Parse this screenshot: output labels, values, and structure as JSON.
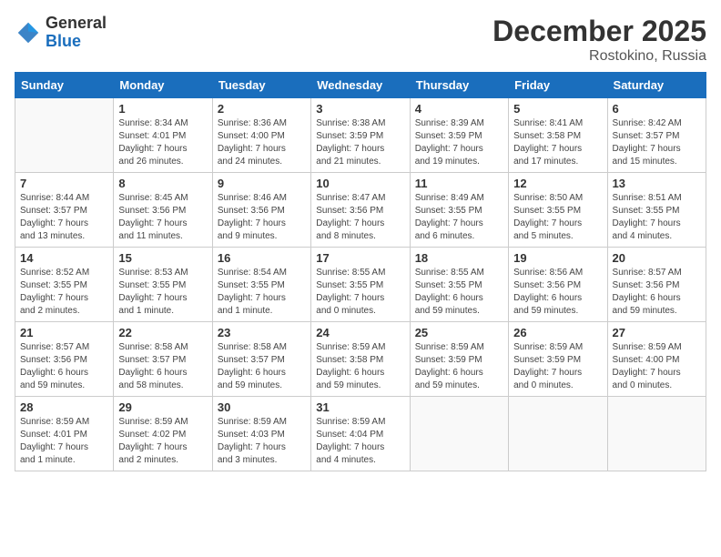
{
  "header": {
    "logo_general": "General",
    "logo_blue": "Blue",
    "title": "December 2025",
    "subtitle": "Rostokino, Russia"
  },
  "days_of_week": [
    "Sunday",
    "Monday",
    "Tuesday",
    "Wednesday",
    "Thursday",
    "Friday",
    "Saturday"
  ],
  "weeks": [
    [
      {
        "day": "",
        "info": ""
      },
      {
        "day": "1",
        "info": "Sunrise: 8:34 AM\nSunset: 4:01 PM\nDaylight: 7 hours\nand 26 minutes."
      },
      {
        "day": "2",
        "info": "Sunrise: 8:36 AM\nSunset: 4:00 PM\nDaylight: 7 hours\nand 24 minutes."
      },
      {
        "day": "3",
        "info": "Sunrise: 8:38 AM\nSunset: 3:59 PM\nDaylight: 7 hours\nand 21 minutes."
      },
      {
        "day": "4",
        "info": "Sunrise: 8:39 AM\nSunset: 3:59 PM\nDaylight: 7 hours\nand 19 minutes."
      },
      {
        "day": "5",
        "info": "Sunrise: 8:41 AM\nSunset: 3:58 PM\nDaylight: 7 hours\nand 17 minutes."
      },
      {
        "day": "6",
        "info": "Sunrise: 8:42 AM\nSunset: 3:57 PM\nDaylight: 7 hours\nand 15 minutes."
      }
    ],
    [
      {
        "day": "7",
        "info": "Sunrise: 8:44 AM\nSunset: 3:57 PM\nDaylight: 7 hours\nand 13 minutes."
      },
      {
        "day": "8",
        "info": "Sunrise: 8:45 AM\nSunset: 3:56 PM\nDaylight: 7 hours\nand 11 minutes."
      },
      {
        "day": "9",
        "info": "Sunrise: 8:46 AM\nSunset: 3:56 PM\nDaylight: 7 hours\nand 9 minutes."
      },
      {
        "day": "10",
        "info": "Sunrise: 8:47 AM\nSunset: 3:56 PM\nDaylight: 7 hours\nand 8 minutes."
      },
      {
        "day": "11",
        "info": "Sunrise: 8:49 AM\nSunset: 3:55 PM\nDaylight: 7 hours\nand 6 minutes."
      },
      {
        "day": "12",
        "info": "Sunrise: 8:50 AM\nSunset: 3:55 PM\nDaylight: 7 hours\nand 5 minutes."
      },
      {
        "day": "13",
        "info": "Sunrise: 8:51 AM\nSunset: 3:55 PM\nDaylight: 7 hours\nand 4 minutes."
      }
    ],
    [
      {
        "day": "14",
        "info": "Sunrise: 8:52 AM\nSunset: 3:55 PM\nDaylight: 7 hours\nand 2 minutes."
      },
      {
        "day": "15",
        "info": "Sunrise: 8:53 AM\nSunset: 3:55 PM\nDaylight: 7 hours\nand 1 minute."
      },
      {
        "day": "16",
        "info": "Sunrise: 8:54 AM\nSunset: 3:55 PM\nDaylight: 7 hours\nand 1 minute."
      },
      {
        "day": "17",
        "info": "Sunrise: 8:55 AM\nSunset: 3:55 PM\nDaylight: 7 hours\nand 0 minutes."
      },
      {
        "day": "18",
        "info": "Sunrise: 8:55 AM\nSunset: 3:55 PM\nDaylight: 6 hours\nand 59 minutes."
      },
      {
        "day": "19",
        "info": "Sunrise: 8:56 AM\nSunset: 3:56 PM\nDaylight: 6 hours\nand 59 minutes."
      },
      {
        "day": "20",
        "info": "Sunrise: 8:57 AM\nSunset: 3:56 PM\nDaylight: 6 hours\nand 59 minutes."
      }
    ],
    [
      {
        "day": "21",
        "info": "Sunrise: 8:57 AM\nSunset: 3:56 PM\nDaylight: 6 hours\nand 59 minutes."
      },
      {
        "day": "22",
        "info": "Sunrise: 8:58 AM\nSunset: 3:57 PM\nDaylight: 6 hours\nand 58 minutes."
      },
      {
        "day": "23",
        "info": "Sunrise: 8:58 AM\nSunset: 3:57 PM\nDaylight: 6 hours\nand 59 minutes."
      },
      {
        "day": "24",
        "info": "Sunrise: 8:59 AM\nSunset: 3:58 PM\nDaylight: 6 hours\nand 59 minutes."
      },
      {
        "day": "25",
        "info": "Sunrise: 8:59 AM\nSunset: 3:59 PM\nDaylight: 6 hours\nand 59 minutes."
      },
      {
        "day": "26",
        "info": "Sunrise: 8:59 AM\nSunset: 3:59 PM\nDaylight: 7 hours\nand 0 minutes."
      },
      {
        "day": "27",
        "info": "Sunrise: 8:59 AM\nSunset: 4:00 PM\nDaylight: 7 hours\nand 0 minutes."
      }
    ],
    [
      {
        "day": "28",
        "info": "Sunrise: 8:59 AM\nSunset: 4:01 PM\nDaylight: 7 hours\nand 1 minute."
      },
      {
        "day": "29",
        "info": "Sunrise: 8:59 AM\nSunset: 4:02 PM\nDaylight: 7 hours\nand 2 minutes."
      },
      {
        "day": "30",
        "info": "Sunrise: 8:59 AM\nSunset: 4:03 PM\nDaylight: 7 hours\nand 3 minutes."
      },
      {
        "day": "31",
        "info": "Sunrise: 8:59 AM\nSunset: 4:04 PM\nDaylight: 7 hours\nand 4 minutes."
      },
      {
        "day": "",
        "info": ""
      },
      {
        "day": "",
        "info": ""
      },
      {
        "day": "",
        "info": ""
      }
    ]
  ]
}
